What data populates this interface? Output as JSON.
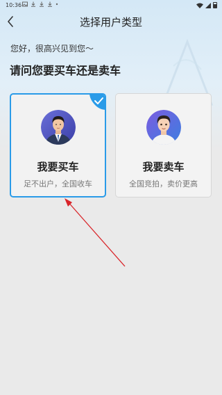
{
  "status_bar": {
    "time": "10:36",
    "left_icons": [
      "image-icon",
      "download-icon",
      "download-icon",
      "download-icon",
      "dot-icon"
    ],
    "right_icons": [
      "wifi-icon",
      "signal-icon",
      "battery-icon"
    ]
  },
  "header": {
    "title": "选择用户类型",
    "back_icon": "chevron-left-icon"
  },
  "intro": {
    "greeting": "您好，很高兴见到您～",
    "question": "请问您要买车还是卖车"
  },
  "options": [
    {
      "title": "我要买车",
      "subtitle": "足不出户，全国收车",
      "selected": true,
      "icon": "businessman-avatar-icon"
    },
    {
      "title": "我要卖车",
      "subtitle": "全国竞拍，卖价更高",
      "selected": false,
      "icon": "young-man-avatar-icon"
    }
  ],
  "colors": {
    "accent": "#2a9be8",
    "annotation_arrow": "#d9252a"
  }
}
